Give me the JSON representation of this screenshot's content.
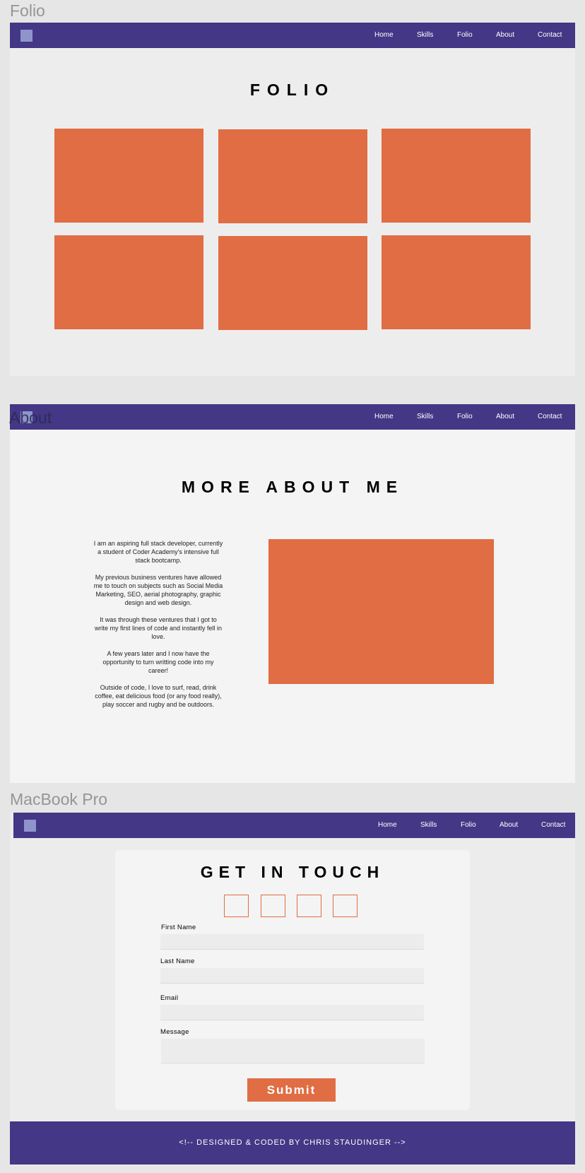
{
  "folio": {
    "frame_label": "Folio",
    "nav": {
      "items": [
        "Home",
        "Skills",
        "Folio",
        "About",
        "Contact"
      ]
    },
    "title": "FOLIO",
    "tile_count": 6
  },
  "about": {
    "frame_label": "About",
    "nav": {
      "items": [
        "Home",
        "Skills",
        "Folio",
        "About",
        "Contact"
      ]
    },
    "title": "MORE ABOUT ME",
    "paragraphs": [
      "I am an aspiring full stack developer, currently a student of Coder Academy's intensive full stack bootcamp.",
      "My previous business ventures have allowed me to touch on subjects such as Social Media Marketing, SEO, aerial photography, graphic design and web design.",
      "It was through these ventures that I got to write my first lines of code and instantly fell in love.",
      "A few years later and I now have the opportunity to turn writting code into my career!",
      "Outside of code, I love to surf, read, drink coffee, eat delicious food (or any food really), play soccer and rugby and be outdoors."
    ]
  },
  "contact": {
    "frame_label": "MacBook Pro",
    "nav": {
      "items": [
        "Home",
        "Skills",
        "Folio",
        "About",
        "Contact"
      ]
    },
    "title": "GET IN TOUCH",
    "social_icons": [
      "social-icon-1",
      "social-icon-2",
      "social-icon-3",
      "social-icon-4"
    ],
    "form": {
      "first_name_label": "First Name",
      "last_name_label": "Last Name",
      "email_label": "Email",
      "message_label": "Message",
      "submit_label": "Submit"
    },
    "footer": "<!--  DESIGNED & CODED BY CHRIS  STAUDINGER  -->"
  },
  "colors": {
    "nav": "#433786",
    "accent": "#e06d43",
    "logo": "#8f94cd",
    "background": "#e6e6e6"
  }
}
